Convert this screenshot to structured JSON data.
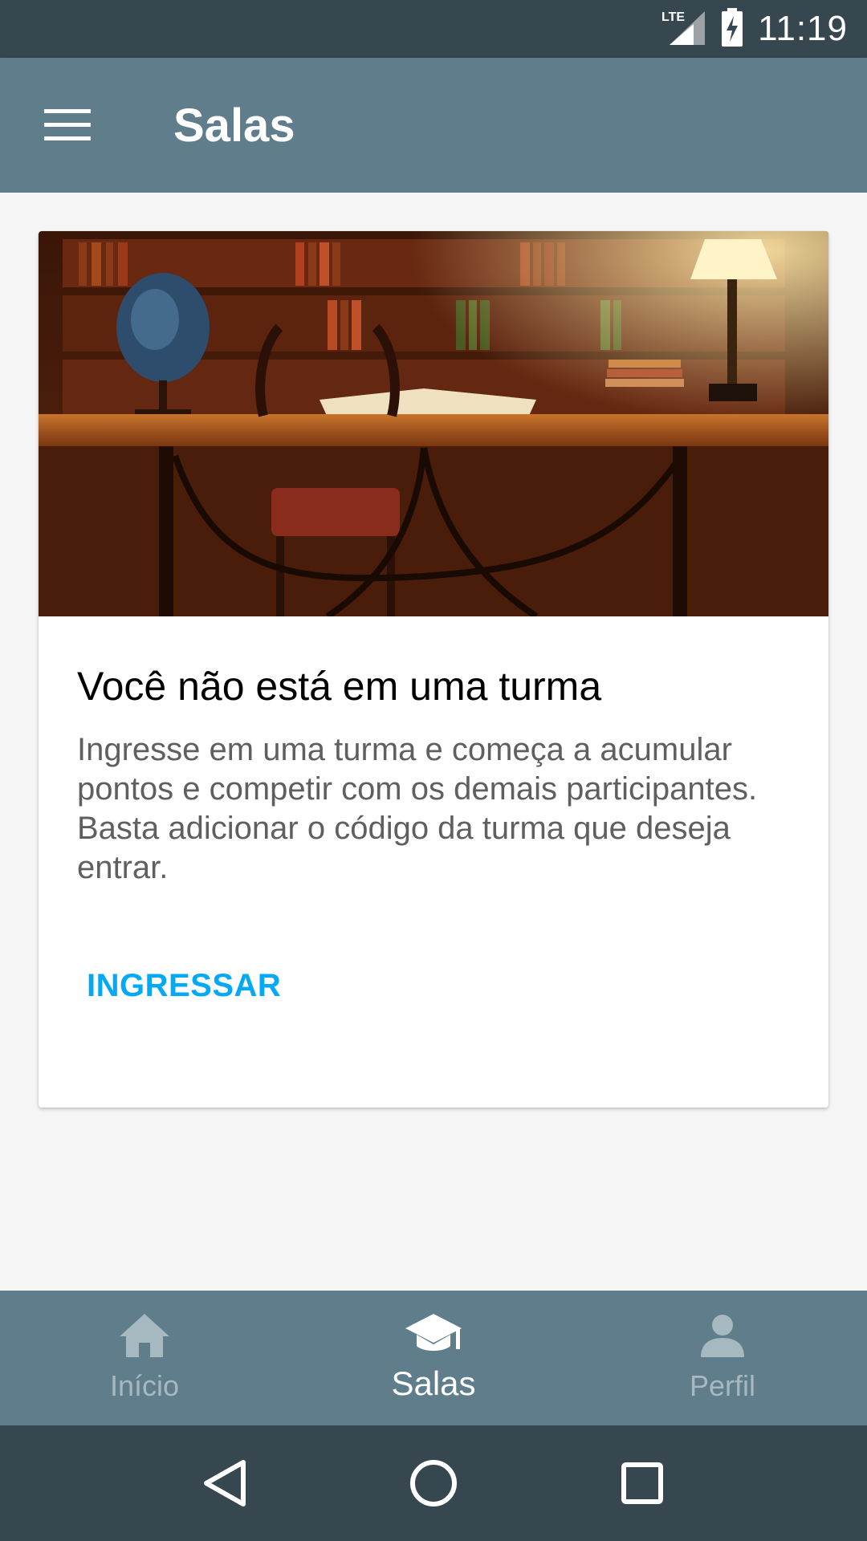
{
  "status": {
    "network": "LTE",
    "time": "11:19"
  },
  "app_bar": {
    "menu_icon": "hamburger-menu-icon",
    "title": "Salas"
  },
  "card": {
    "image": "library-desk-photo",
    "title": "Você não está em uma turma",
    "text": "Ingresse em uma turma e começa a acumular pontos e competir com os demais participantes. Basta adicionar o código da turma que deseja entrar.",
    "action_label": "INGRESSAR",
    "action_color": "#03a9f4"
  },
  "bottom_nav": {
    "items": [
      {
        "label": "Início",
        "icon": "home-icon",
        "active": false
      },
      {
        "label": "Salas",
        "icon": "school-icon",
        "active": true
      },
      {
        "label": "Perfil",
        "icon": "person-icon",
        "active": false
      }
    ]
  },
  "colors": {
    "status_bar": "#37474f",
    "app_bar": "#607d8b",
    "accent": "#03a9f4"
  }
}
